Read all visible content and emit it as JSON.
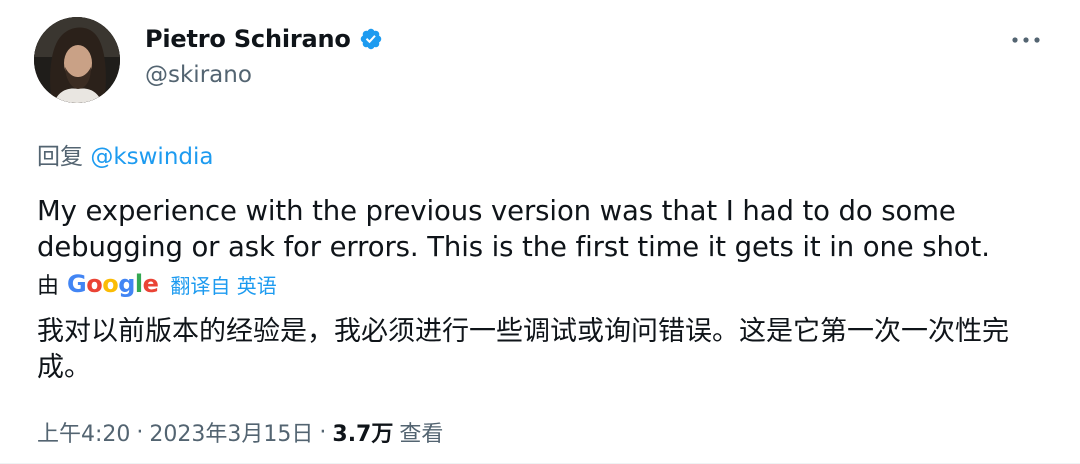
{
  "author": {
    "display_name": "Pietro Schirano",
    "handle": "@skirano",
    "verified": true
  },
  "reply_to": {
    "prefix": "回复",
    "mention": "@kswindia"
  },
  "tweet": {
    "text": "My experience with the previous version was that I had to do some debugging or ask for errors. This is the first time it gets it in one shot."
  },
  "translation_bar": {
    "by_label": "由",
    "google_logo": "Google",
    "link_text": "翻译自 英语"
  },
  "translation": {
    "text": "我对以前版本的经验是，我必须进行一些调试或询问错误。这是它第一次一次性完成。"
  },
  "meta": {
    "time": "上午4:20",
    "separator": "·",
    "date": "2023年3月15日",
    "views_count": "3.7万",
    "views_label": "查看"
  },
  "colors": {
    "accent": "#1d9bf0",
    "secondary_text": "#536471",
    "primary_text": "#0f1419",
    "verified_badge": "#1d9bf0",
    "google_blue": "#4285f4",
    "google_red": "#ea4335",
    "google_yellow": "#fbbc05",
    "google_green": "#34a853"
  },
  "icons": {
    "verified": "verified-badge-icon",
    "more": "more-horizontal-icon"
  }
}
